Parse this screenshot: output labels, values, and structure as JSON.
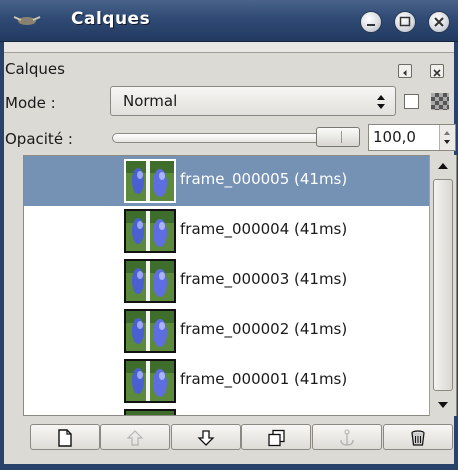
{
  "window": {
    "title": "Calques",
    "controls": [
      "minimize",
      "maximize",
      "close"
    ]
  },
  "dock": {
    "label": "Calques"
  },
  "mode": {
    "label": "Mode :",
    "value": "Normal"
  },
  "opacity": {
    "label": "Opacité :",
    "value": "100,0",
    "level": 1.0
  },
  "layers": [
    {
      "name": "frame_000005 (41ms)",
      "selected": true
    },
    {
      "name": "frame_000004 (41ms)",
      "selected": false
    },
    {
      "name": "frame_000003 (41ms)",
      "selected": false
    },
    {
      "name": "frame_000002 (41ms)",
      "selected": false
    },
    {
      "name": "frame_000001 (41ms)",
      "selected": false
    }
  ],
  "toolbar": {
    "buttons": [
      {
        "icon": "new-layer-icon",
        "enabled": true
      },
      {
        "icon": "raise-layer-icon",
        "enabled": false
      },
      {
        "icon": "lower-layer-icon",
        "enabled": true
      },
      {
        "icon": "duplicate-layer-icon",
        "enabled": true
      },
      {
        "icon": "anchor-layer-icon",
        "enabled": false
      },
      {
        "icon": "delete-layer-icon",
        "enabled": true
      }
    ]
  },
  "colors": {
    "titlebar": "#2f4a74",
    "selection": "#7592b5"
  }
}
